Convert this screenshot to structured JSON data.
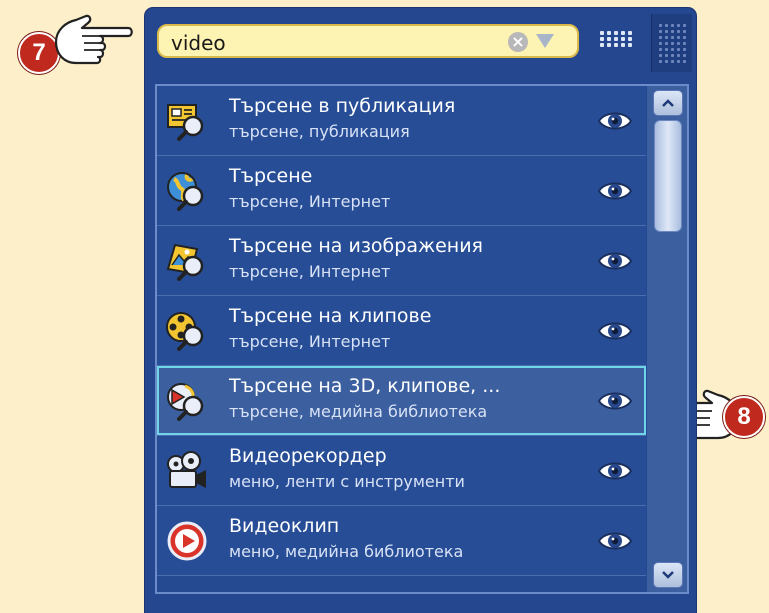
{
  "callouts": {
    "first": "7",
    "second": "8"
  },
  "search": {
    "value": "video",
    "clear_icon": "×"
  },
  "results": [
    {
      "title": "Търсене в публикация",
      "subtitle": "търсене, публикация",
      "icon": "search-publication-icon"
    },
    {
      "title": "Търсене",
      "subtitle": "търсене, Интернет",
      "icon": "web-search-icon"
    },
    {
      "title": "Търсене на изображения",
      "subtitle": "търсене, Интернет",
      "icon": "image-search-icon"
    },
    {
      "title": "Търсене на клипове",
      "subtitle": "търсене, Интернет",
      "icon": "clip-search-icon"
    },
    {
      "title": "Търсене на 3D, клипове, ...",
      "subtitle": "търсене, медийна библиотека",
      "icon": "media-search-icon",
      "selected": true
    },
    {
      "title": "Видеорекордер",
      "subtitle": "меню, ленти с инструменти",
      "icon": "video-recorder-icon"
    },
    {
      "title": "Видеоклип",
      "subtitle": "меню, медийна библиотека",
      "icon": "video-clip-icon"
    }
  ],
  "colors": {
    "accent": "#24478f",
    "badge": "#c0291d",
    "search_bg": "#fdf3b2",
    "selection": "#6fd6e8"
  }
}
